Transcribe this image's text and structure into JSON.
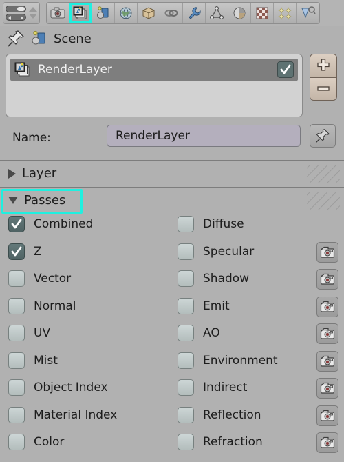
{
  "toolbar": {
    "editor_selector_name": "editor-type-selector",
    "buttons": [
      {
        "name": "render-tab",
        "icon": "camera-icon",
        "active": false
      },
      {
        "name": "render-layers-tab",
        "icon": "render-layers-icon",
        "active": true
      },
      {
        "name": "scene-tab",
        "icon": "scene-icon",
        "active": false
      },
      {
        "name": "world-tab",
        "icon": "world-globe-icon",
        "active": false
      },
      {
        "name": "object-tab",
        "icon": "object-cube-icon",
        "active": false
      },
      {
        "name": "constraints-tab",
        "icon": "chain-link-icon",
        "active": false
      },
      {
        "name": "modifiers-tab",
        "icon": "wrench-icon",
        "active": false
      },
      {
        "name": "data-tab",
        "icon": "mesh-data-icon",
        "active": false
      },
      {
        "name": "material-tab",
        "icon": "material-sphere-icon",
        "active": false
      },
      {
        "name": "texture-tab",
        "icon": "checker-texture-icon",
        "active": false
      },
      {
        "name": "particles-tab",
        "icon": "particles-icon",
        "active": false
      },
      {
        "name": "physics-tab",
        "icon": "physics-icon",
        "active": false
      }
    ]
  },
  "breadcrumb": {
    "pin_icon": "pin-icon",
    "scene_icon": "scene-icon",
    "scene_label": "Scene"
  },
  "render_layers": {
    "items": [
      {
        "label": "RenderLayer",
        "enabled": true,
        "icon": "render-layers-icon"
      }
    ],
    "add_label": "+",
    "remove_label": "–"
  },
  "name_row": {
    "label": "Name:",
    "value": "RenderLayer",
    "placeholder": "RenderLayer",
    "pin_icon": "pin-icon"
  },
  "panels": [
    {
      "title": "Layer",
      "expanded": false,
      "highlighted": false
    },
    {
      "title": "Passes",
      "expanded": true,
      "highlighted": true
    }
  ],
  "passes": {
    "rows": [
      {
        "left": {
          "label": "Combined",
          "checked": true
        },
        "right": {
          "label": "Diffuse",
          "checked": false,
          "exclude": false
        }
      },
      {
        "left": {
          "label": "Z",
          "checked": true
        },
        "right": {
          "label": "Specular",
          "checked": false,
          "exclude": true
        }
      },
      {
        "left": {
          "label": "Vector",
          "checked": false
        },
        "right": {
          "label": "Shadow",
          "checked": false,
          "exclude": true
        }
      },
      {
        "left": {
          "label": "Normal",
          "checked": false
        },
        "right": {
          "label": "Emit",
          "checked": false,
          "exclude": true
        }
      },
      {
        "left": {
          "label": "UV",
          "checked": false
        },
        "right": {
          "label": "AO",
          "checked": false,
          "exclude": true
        }
      },
      {
        "left": {
          "label": "Mist",
          "checked": false
        },
        "right": {
          "label": "Environment",
          "checked": false,
          "exclude": true
        }
      },
      {
        "left": {
          "label": "Object Index",
          "checked": false
        },
        "right": {
          "label": "Indirect",
          "checked": false,
          "exclude": true
        }
      },
      {
        "left": {
          "label": "Material Index",
          "checked": false
        },
        "right": {
          "label": "Reflection",
          "checked": false,
          "exclude": true
        }
      },
      {
        "left": {
          "label": "Color",
          "checked": false
        },
        "right": {
          "label": "Refraction",
          "checked": false,
          "exclude": true
        }
      }
    ],
    "exclude_icon": "exclude-pass-camera-icon"
  },
  "colors": {
    "background": "#b1b1b1",
    "highlight": "#1ff0e0",
    "checkbox_on": "#5a6e6f",
    "list_selected": "#7e7e7e",
    "field": "#b4afbd",
    "side_button": "#cfc1b3"
  }
}
